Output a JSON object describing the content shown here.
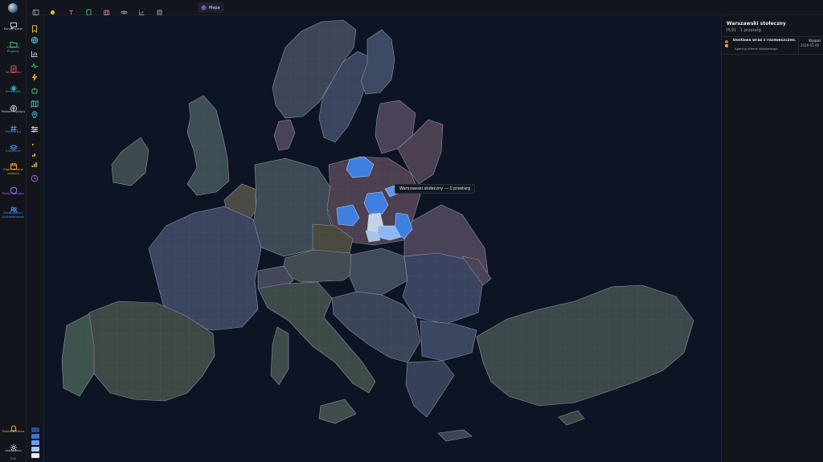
{
  "nav": {
    "items": [
      {
        "label": "Konwersacje",
        "color": "#c9ced8",
        "icon": "chat-icon"
      },
      {
        "label": "Klienci & Projekty",
        "color": "#46c46a",
        "icon": "folder-icon"
      },
      {
        "label": "Tabularium",
        "color": "#e05a5a",
        "icon": "table-icon"
      },
      {
        "label": "Schematic",
        "color": "#3fb6c8",
        "icon": "sparkle-icon"
      },
      {
        "label": "Partner myślący",
        "color": "#c9ced8",
        "icon": "brain-icon"
      },
      {
        "label": "Konwertuj",
        "color": "#4f8fe8",
        "icon": "hash-icon"
      },
      {
        "label": "Integracje",
        "color": "#4f8fe8",
        "icon": "layers-icon"
      },
      {
        "label": "Zaplanowane zadania",
        "color": "#e3a832",
        "icon": "calendar-icon"
      },
      {
        "label": "Polisk operator",
        "color": "#a56de2",
        "icon": "shield-icon"
      },
      {
        "label": "Zarządzanie i Użytkownikami",
        "color": "#4f8fe8",
        "icon": "users-icon"
      }
    ],
    "bottom": [
      {
        "label": "Powiadomienia",
        "color": "#e3a832",
        "icon": "bell-icon"
      },
      {
        "label": "Ustawienia",
        "color": "#c9ced8",
        "icon": "gear-icon"
      },
      {
        "label": "Trial",
        "color": "#8a92a0",
        "icon": "trial-label"
      }
    ]
  },
  "topbar": {
    "icons": [
      {
        "name": "sidebar-toggle-icon",
        "color": "#9aa3b2"
      },
      {
        "name": "coin-icon",
        "color": "#e3b23c"
      },
      {
        "name": "pin-icon",
        "color": "#e05a5a"
      },
      {
        "name": "document-icon",
        "color": "#46c46a"
      },
      {
        "name": "people-icon",
        "color": "#e26a8d"
      },
      {
        "name": "eye-icon",
        "color": "#8a92a0"
      },
      {
        "name": "chart-icon",
        "color": "#8a92a0"
      },
      {
        "name": "database-icon",
        "color": "#8a92a0"
      }
    ],
    "active_tab": {
      "label": "Mapa",
      "icon": "globe-icon",
      "color": "#a56de2"
    }
  },
  "tools": [
    {
      "name": "bookmark-icon",
      "color": "#e3b23c"
    },
    {
      "name": "globe-icon",
      "color": "#3fb6c8"
    },
    {
      "name": "bar-chart-icon",
      "color": "#c9ced8"
    },
    {
      "name": "activity-icon",
      "color": "#46c46a"
    },
    {
      "name": "lightning-icon",
      "color": "#e3b23c"
    },
    {
      "name": "robot-icon",
      "color": "#46c46a"
    },
    {
      "name": "map-icon",
      "color": "#3fb6c8"
    },
    {
      "name": "location-pin-icon",
      "color": "#3fb6c8"
    },
    {
      "name": "sliders-icon",
      "color": "#c9ced8"
    },
    {
      "name": "signal-1-icon",
      "color": "#e3b23c"
    },
    {
      "name": "signal-2-icon",
      "color": "#e3b23c"
    },
    {
      "name": "signal-3-icon",
      "color": "#e3b23c"
    },
    {
      "name": "clock-icon",
      "color": "#a56de2"
    }
  ],
  "legend": [
    "#2a4f8f",
    "#3b74d6",
    "#6a9eef",
    "#a9c7f4",
    "#e4ebf6"
  ],
  "map": {
    "tooltip": "Warszawski stołeczny — 1 przetarg",
    "highlight_colors": {
      "strong": "#3f7fe0",
      "medium": "#5f96ea",
      "light": "#8fb8ef",
      "pale": "#c4d3e6"
    }
  },
  "panel": {
    "title": "Warszawski stołeczny",
    "subtitle": "PL91 · 1 przetarg",
    "rows": [
      {
        "title": "Dostawa wraz z rozmieszczen...",
        "subtitle": "Agencja Mienia Wojskowego",
        "badge": "Wygasł",
        "date": "2026-05-06",
        "dot_top": "#e05a5a",
        "dot_bottom": "#e3b23c"
      }
    ]
  }
}
